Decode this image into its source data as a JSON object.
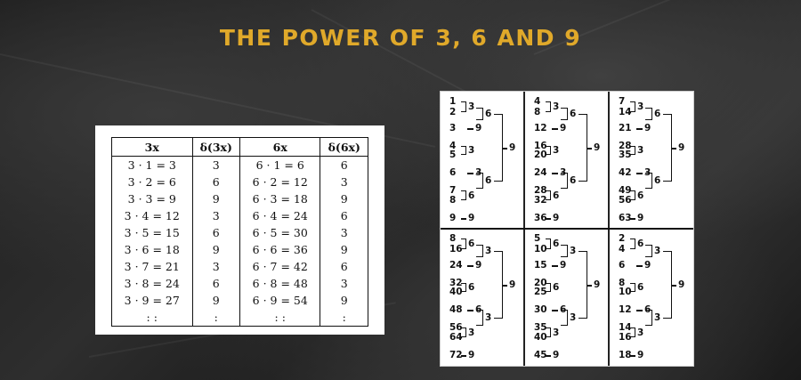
{
  "title": "THE POWER OF 3, 6 AND 9",
  "table": {
    "headers": [
      "3x",
      "δ(3x)",
      "6x",
      "δ(6x)"
    ],
    "rows": [
      [
        "3 · 1 = 3",
        "3",
        "6 · 1 = 6",
        "6"
      ],
      [
        "3 · 2 = 6",
        "6",
        "6 · 2 = 12",
        "3"
      ],
      [
        "3 · 3 = 9",
        "9",
        "6 · 3 = 18",
        "9"
      ],
      [
        "3 · 4 = 12",
        "3",
        "6 · 4 = 24",
        "6"
      ],
      [
        "3 · 5 = 15",
        "6",
        "6 · 5 = 30",
        "3"
      ],
      [
        "3 · 6 = 18",
        "9",
        "6 · 6 = 36",
        "9"
      ],
      [
        "3 · 7 = 21",
        "3",
        "6 · 7 = 42",
        "6"
      ],
      [
        "3 · 8 = 24",
        "6",
        "6 · 8 = 48",
        "3"
      ],
      [
        "3 · 9 = 27",
        "9",
        "6 · 9 = 54",
        "9"
      ],
      [
        ": :",
        ":",
        ": :",
        ":"
      ]
    ]
  },
  "grid": {
    "cells": [
      {
        "n": [
          "1",
          "2",
          "3",
          "4",
          "5",
          "6",
          "7",
          "8",
          "9"
        ],
        "r": [
          "3",
          "6",
          "9",
          "3",
          "6",
          "3",
          "6",
          "9",
          "9"
        ],
        "last": "9"
      },
      {
        "n": [
          "4",
          "8",
          "12",
          "16",
          "20",
          "24",
          "28",
          "32",
          "36"
        ],
        "r": [
          "3",
          "6",
          "9",
          "3",
          "6",
          "3",
          "6",
          "9",
          "9"
        ],
        "last": "9"
      },
      {
        "n": [
          "7",
          "14",
          "21",
          "28",
          "35",
          "42",
          "49",
          "56",
          "63"
        ],
        "r": [
          "3",
          "6",
          "9",
          "3",
          "6",
          "3",
          "6",
          "9",
          "9"
        ],
        "last": "9"
      },
      {
        "n": [
          "8",
          "16",
          "24",
          "32",
          "40",
          "48",
          "56",
          "64",
          "72"
        ],
        "r": [
          "6",
          "3",
          "9",
          "6",
          "3",
          "6",
          "3",
          "9",
          "9"
        ],
        "last": "9"
      },
      {
        "n": [
          "5",
          "10",
          "15",
          "20",
          "25",
          "30",
          "35",
          "40",
          "45"
        ],
        "r": [
          "6",
          "3",
          "9",
          "6",
          "3",
          "6",
          "3",
          "9",
          "9"
        ],
        "last": "9"
      },
      {
        "n": [
          "2",
          "4",
          "6",
          "8",
          "10",
          "12",
          "14",
          "16",
          "18"
        ],
        "r": [
          "6",
          "3",
          "9",
          "6",
          "3",
          "6",
          "3",
          "9",
          "9"
        ],
        "last": "9"
      }
    ]
  }
}
